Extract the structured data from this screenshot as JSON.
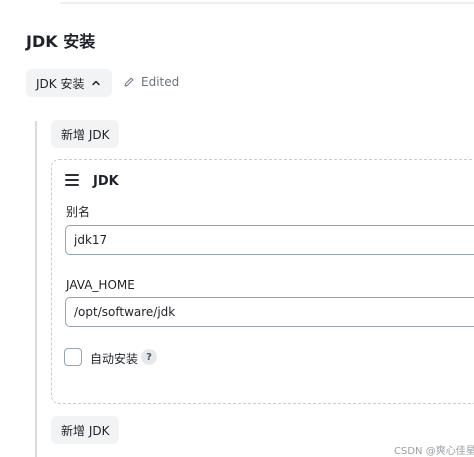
{
  "section": {
    "title": "JDK 安装"
  },
  "toggle": {
    "label": "JDK 安装",
    "chevron_icon": "chevron-up-icon"
  },
  "status": {
    "label": "Edited",
    "icon": "pencil-icon"
  },
  "actions": {
    "add_top_label": "新增 JDK",
    "add_bottom_label": "新增 JDK"
  },
  "jdk_item": {
    "title": "JDK",
    "drag_icon": "drag-handle-icon",
    "alias_label": "别名",
    "alias_value": "jdk17",
    "home_label": "JAVA_HOME",
    "home_value": "/opt/software/jdk",
    "auto_install_label": "自动安装",
    "auto_install_checked": false,
    "help_text": "?"
  },
  "watermark": "CSDN @爽心佳星",
  "colors": {
    "background": "#ffffff",
    "button_bg": "#f2f3f5",
    "border": "#9aa4ae",
    "muted": "#6b7280"
  }
}
